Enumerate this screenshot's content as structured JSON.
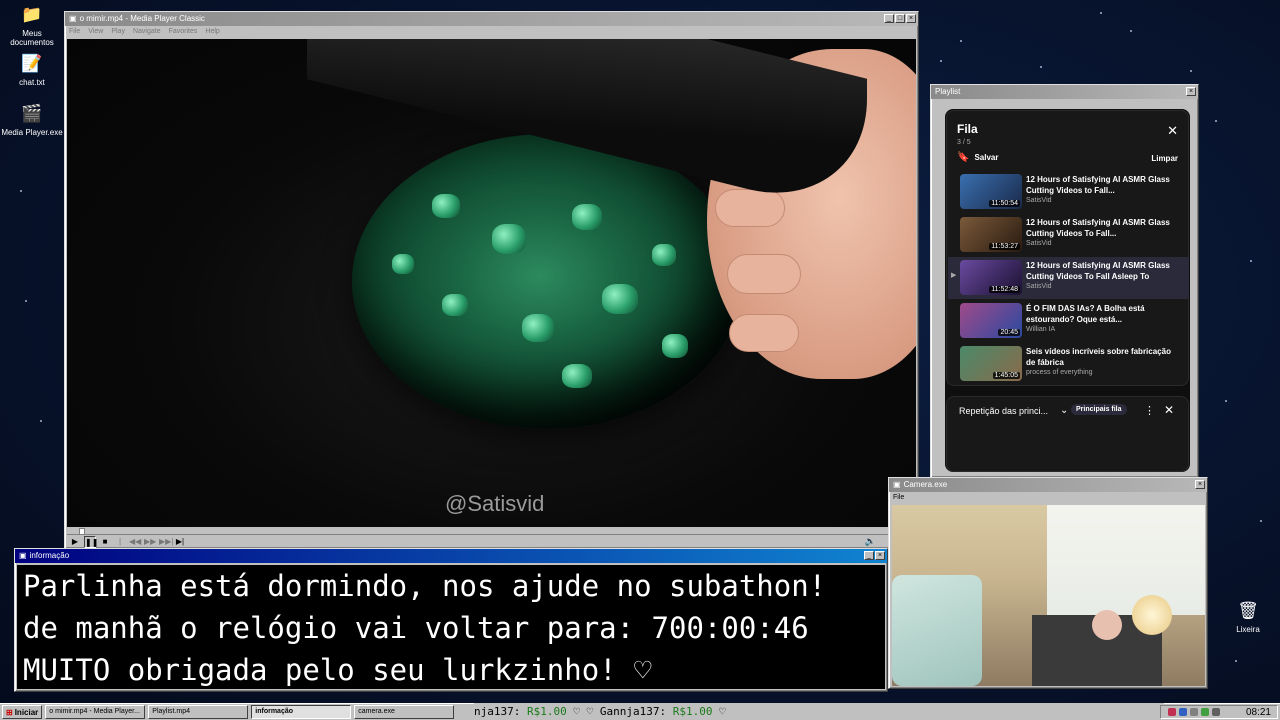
{
  "desktop": {
    "icons": [
      {
        "label": "Meus documentos",
        "icon": "folder-icon"
      },
      {
        "label": "chat.txt",
        "icon": "notepad-icon"
      },
      {
        "label": "Media Player.exe",
        "icon": "media-player-icon"
      },
      {
        "label": "Lixeira",
        "icon": "recycle-bin-icon"
      }
    ]
  },
  "media_player": {
    "title": "o mimir.mp4 - Media Player Classic",
    "menu": [
      "File",
      "View",
      "Play",
      "Navigate",
      "Favorites",
      "Help"
    ],
    "watermark": "@Satisvid",
    "progress": 0.01
  },
  "playlist": {
    "window_title": "Playlist",
    "header": "Fila",
    "count": "3 / 5",
    "save_label": "Salvar",
    "clear_label": "Limpar",
    "items": [
      {
        "title": "12 Hours of Satisfying AI ASMR Glass Cutting Videos to Fall...",
        "channel": "SatisVid",
        "duration": "11:50:54",
        "color": "#3a6fb0",
        "now_playing": false
      },
      {
        "title": "12 Hours of Satisfying AI ASMR Glass Cutting Videos To Fall...",
        "channel": "SatisVid",
        "duration": "11:53:27",
        "color": "#7a5a3a",
        "now_playing": false
      },
      {
        "title": "12 Hours of Satisfying AI ASMR Glass Cutting Videos To Fall Asleep To",
        "channel": "SatisVid",
        "duration": "11:52:48",
        "color": "#6a4aa0",
        "now_playing": true
      },
      {
        "title": "É O FIM DAS IAs? A Bolha está estourando? Oque está...",
        "channel": "Willian IA",
        "duration": "20:45",
        "color": "#a04a8a",
        "now_playing": false
      },
      {
        "title": "Seis vídeos incríveis sobre fabricação de fábrica",
        "channel": "process of everything",
        "duration": "1:45:05",
        "color": "#4a8a6a",
        "now_playing": false
      }
    ],
    "playing_indicator": "▶",
    "repeat_label": "Repetição das princi...",
    "badge_label": "Principais fila"
  },
  "info_window": {
    "title": "informação",
    "lines": [
      "Parlinha está dormindo, nos ajude no subathon!",
      "de manhã o relógio vai voltar para:  700:00:46",
      "MUITO obrigada pelo seu lurkzinho! ♡"
    ]
  },
  "camera": {
    "title": "Camera.exe",
    "menu_file": "File"
  },
  "taskbar": {
    "start_label": "Iniciar",
    "tasks": [
      {
        "label": "o mimir.mp4 - Media Player...",
        "active": false
      },
      {
        "label": "Playlist.mp4",
        "active": false
      },
      {
        "label": "informação",
        "active": true
      },
      {
        "label": "camera.exe",
        "active": false
      }
    ],
    "ticker_a": "nja137: ",
    "ticker_a_amount": "R$1.00",
    "ticker_a_heart": " ♡     ♡ ",
    "ticker_b": "Gannja137: ",
    "ticker_b_amount": "R$1.00",
    "ticker_b_heart": " ♡",
    "clock": "08:21"
  },
  "colors": {
    "titlebar_active": "#000080",
    "youtube_bg": "#0f0f0f",
    "donation_green": "#1a7a1a"
  }
}
